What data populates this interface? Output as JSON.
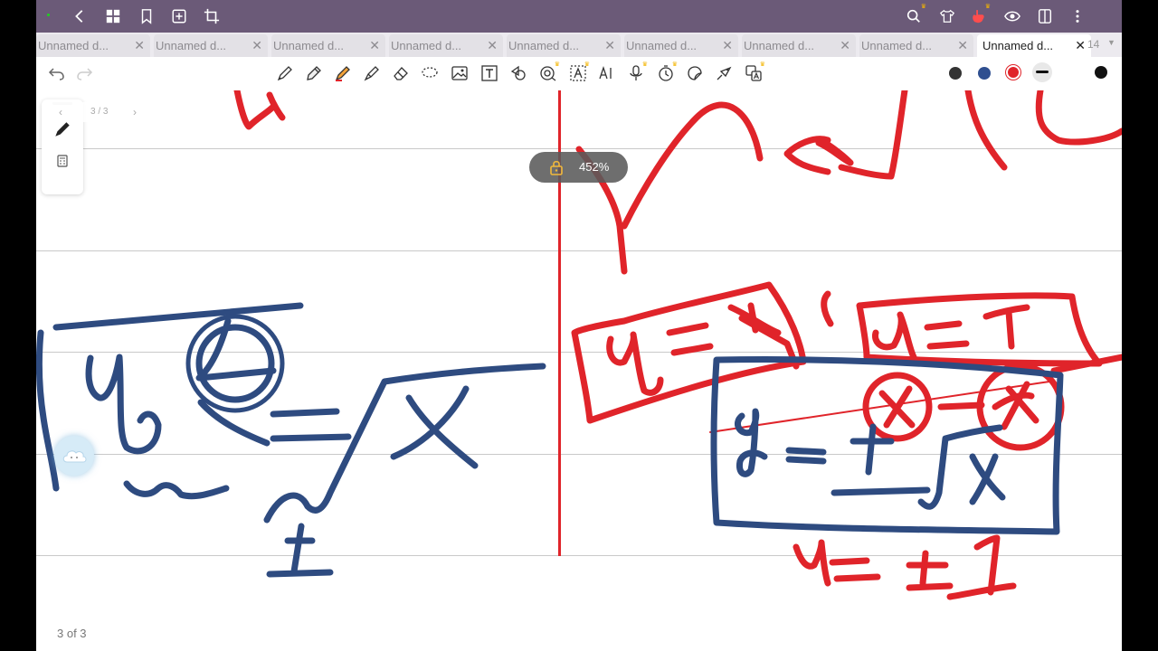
{
  "tabs": [
    {
      "label": "Unnamed d...",
      "active": false
    },
    {
      "label": "Unnamed d...",
      "active": false
    },
    {
      "label": "Unnamed d...",
      "active": false
    },
    {
      "label": "Unnamed d...",
      "active": false
    },
    {
      "label": "Unnamed d...",
      "active": false
    },
    {
      "label": "Unnamed d...",
      "active": false
    },
    {
      "label": "Unnamed d...",
      "active": false
    },
    {
      "label": "Unnamed d...",
      "active": false
    },
    {
      "label": "Unnamed d...",
      "active": true
    }
  ],
  "tab_overflow": {
    "count": "14",
    "more_icon": "caret-down-icon"
  },
  "colors": {
    "topbar": "#6b5a78",
    "ink_blue": "#2e4b80",
    "ink_red": "#e0242a",
    "swatch_dark": "#333333",
    "swatch_blue": "#2f4f90",
    "swatch_red": "#e0242a"
  },
  "page_nav": {
    "text": "3 / 3"
  },
  "zoom": {
    "text": "452%",
    "locked_icon": "lock-icon"
  },
  "footer": {
    "page_label": "3 of 3"
  }
}
